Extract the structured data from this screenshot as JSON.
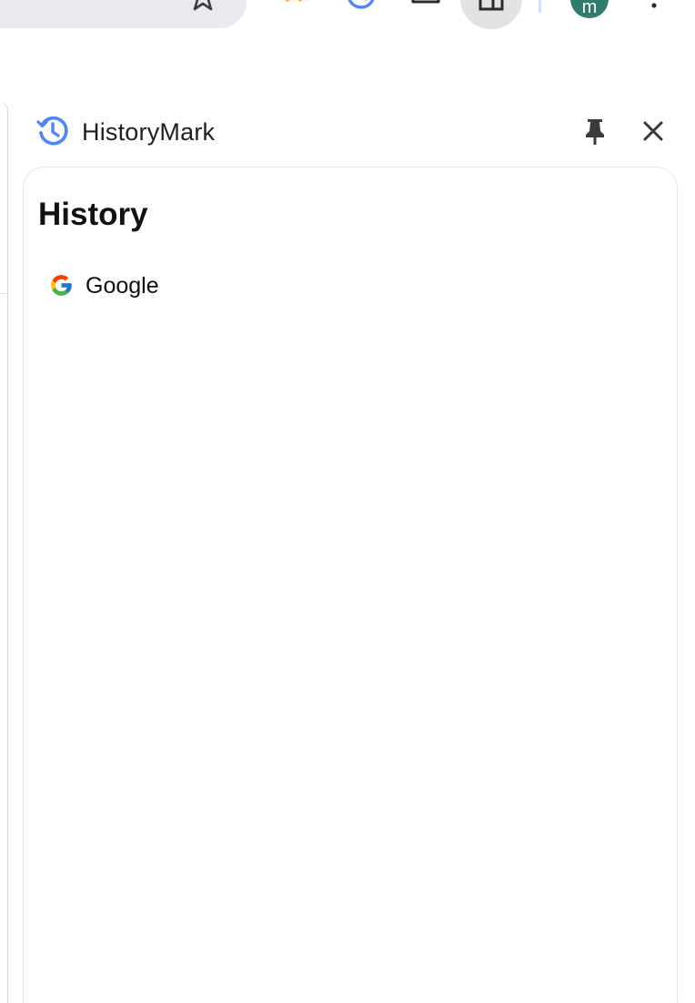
{
  "toolbar": {
    "avatar_letter": "m",
    "icons": [
      "star-icon",
      "w-extension-icon",
      "history-extension-icon",
      "puzzle-extension-icon",
      "side-panel-icon",
      "kebab-menu-icon"
    ],
    "colors": {
      "omnibox_bg": "#e8eaf0",
      "avatar_bg": "#2f7b6d",
      "side_panel_btn_bg": "#e2e2e2"
    }
  },
  "side_panel": {
    "title": "HistoryMark",
    "logo_icon": "history-clock-icon",
    "pin_icon": "pin-icon",
    "close_icon": "close-icon",
    "accent_color": "#4285f4"
  },
  "content": {
    "heading": "History",
    "items": [
      {
        "title": "Google",
        "favicon": "google-g-icon"
      }
    ]
  }
}
